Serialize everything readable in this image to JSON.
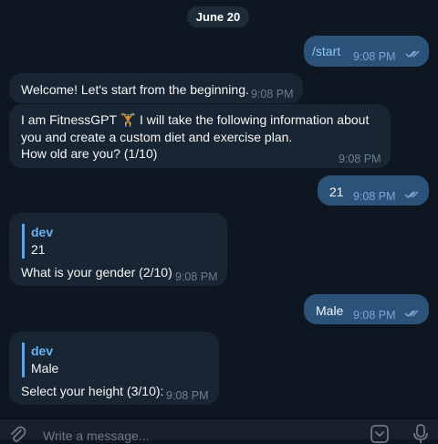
{
  "chat": {
    "date_label": "June 20",
    "messages": [
      {
        "type": "out",
        "text": "/start",
        "time": "9:08 PM"
      },
      {
        "type": "in",
        "text": "Welcome! Let's start from the beginning.",
        "time": "9:08 PM"
      },
      {
        "type": "in",
        "lines": [
          "I am FitnessGPT 🏋 I will take the following information about",
          "you and create a custom diet and exercise plan.",
          "How old are you? (1/10)"
        ],
        "time": "9:08 PM"
      },
      {
        "type": "out",
        "text": "21",
        "time": "9:08 PM"
      },
      {
        "type": "in",
        "reply_name": "dev",
        "reply_text": "21",
        "text": "What is your gender (2/10)",
        "time": "9:08 PM"
      },
      {
        "type": "out",
        "text": "Male",
        "time": "9:08 PM"
      },
      {
        "type": "in",
        "reply_name": "dev",
        "reply_text": "Male",
        "text": "Select your height (3/10):",
        "time": "9:08 PM"
      }
    ]
  },
  "composer": {
    "placeholder": "Write a message..."
  },
  "colors": {
    "background": "#0e1621",
    "incoming": "#182533",
    "outgoing": "#2b5278",
    "accent": "#6ab3f3"
  },
  "icons": [
    "double-check-icon",
    "attach-icon",
    "emoji-icon",
    "microphone-icon",
    "weightlifter-emoji"
  ]
}
